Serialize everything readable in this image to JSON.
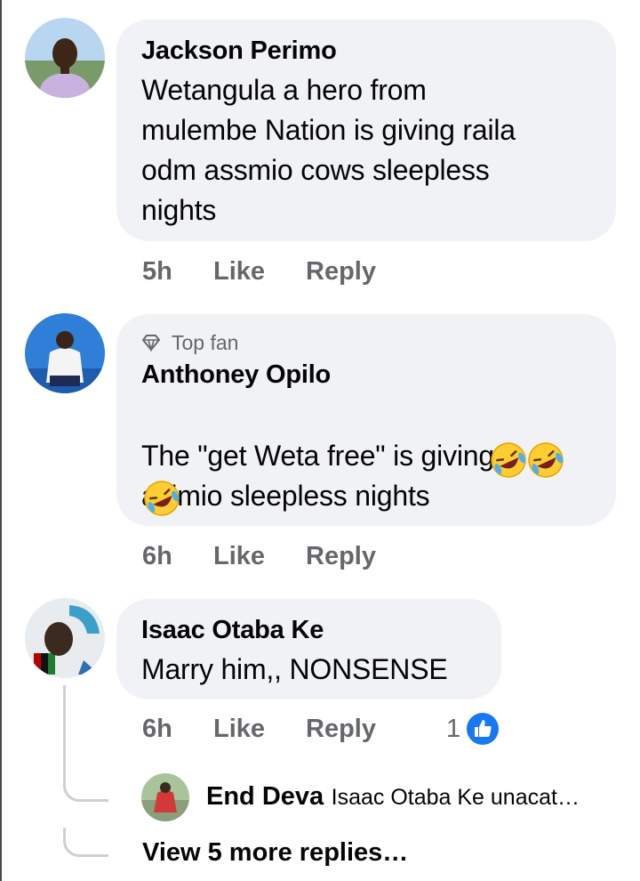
{
  "comments": [
    {
      "author": "Jackson Perimo",
      "text": "Wetangula a hero from\nmulembe Nation is giving raila\nodm assmio cows sleepless\nnights",
      "time": "5h",
      "like_label": "Like",
      "reply_label": "Reply"
    },
    {
      "badge": "Top fan",
      "author": "Anthoney Opilo",
      "text": "The \"get Weta free\" is giving\nasimio sleepless nights",
      "emoji": [
        "rolling-on-floor-laughing",
        "rolling-on-floor-laughing",
        "rolling-on-floor-laughing"
      ],
      "time": "6h",
      "like_label": "Like",
      "reply_label": "Reply"
    },
    {
      "author": "Isaac Otaba Ke",
      "text": "Marry him,, NONSENSE",
      "time": "6h",
      "like_label": "Like",
      "reply_label": "Reply",
      "reaction_count": "1",
      "reaction_icon": "like-icon",
      "reaction_color": "#1877f2"
    }
  ],
  "reply_preview": {
    "author": "End Deva",
    "text": "Isaac Otaba Ke unacat…"
  },
  "view_more": "View 5 more replies…",
  "colors": {
    "bubble": "#f0f2f5",
    "meta": "#65676b",
    "like_blue": "#1877f2",
    "thread_line": "#ced0d4"
  }
}
